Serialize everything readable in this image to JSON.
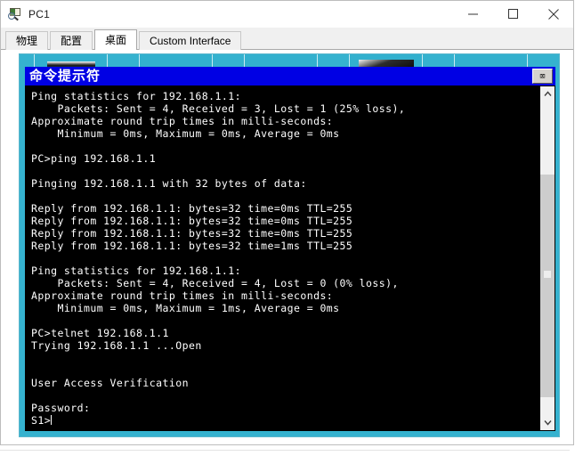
{
  "window": {
    "title": "PC1",
    "icon": "pc-magnifier-icon",
    "minimize_label": "—",
    "maximize_label": "□",
    "close_label": "✕"
  },
  "tabs": [
    {
      "label": "物理",
      "active": false
    },
    {
      "label": "配置",
      "active": false
    },
    {
      "label": "桌面",
      "active": true
    },
    {
      "label": "Custom Interface",
      "active": false
    }
  ],
  "desktop": {
    "background_color": "#35b2cf",
    "icons": [
      {
        "name": "desktop-icon-1"
      },
      {
        "name": "desktop-icon-2"
      },
      {
        "name": "desktop-icon-3"
      },
      {
        "name": "desktop-icon-4"
      },
      {
        "name": "desktop-icon-5"
      }
    ]
  },
  "terminal": {
    "title": "命令提示符",
    "titlebar_color": "#0000e4",
    "text_color": "#ffffff",
    "background_color": "#000000",
    "close_button_label": "⌧",
    "scrollbar": {
      "up_arrow": "⌃",
      "down_arrow": "⌄"
    },
    "lines": [
      "Ping statistics for 192.168.1.1:",
      "    Packets: Sent = 4, Received = 3, Lost = 1 (25% loss),",
      "Approximate round trip times in milli-seconds:",
      "    Minimum = 0ms, Maximum = 0ms, Average = 0ms",
      "",
      "PC>ping 192.168.1.1",
      "",
      "Pinging 192.168.1.1 with 32 bytes of data:",
      "",
      "Reply from 192.168.1.1: bytes=32 time=0ms TTL=255",
      "Reply from 192.168.1.1: bytes=32 time=0ms TTL=255",
      "Reply from 192.168.1.1: bytes=32 time=0ms TTL=255",
      "Reply from 192.168.1.1: bytes=32 time=1ms TTL=255",
      "",
      "Ping statistics for 192.168.1.1:",
      "    Packets: Sent = 4, Received = 4, Lost = 0 (0% loss),",
      "Approximate round trip times in milli-seconds:",
      "    Minimum = 0ms, Maximum = 1ms, Average = 0ms",
      "",
      "PC>telnet 192.168.1.1",
      "Trying 192.168.1.1 ...Open",
      "",
      "",
      "User Access Verification",
      "",
      "Password:",
      "S1>"
    ],
    "prompt_line_index": 26
  }
}
